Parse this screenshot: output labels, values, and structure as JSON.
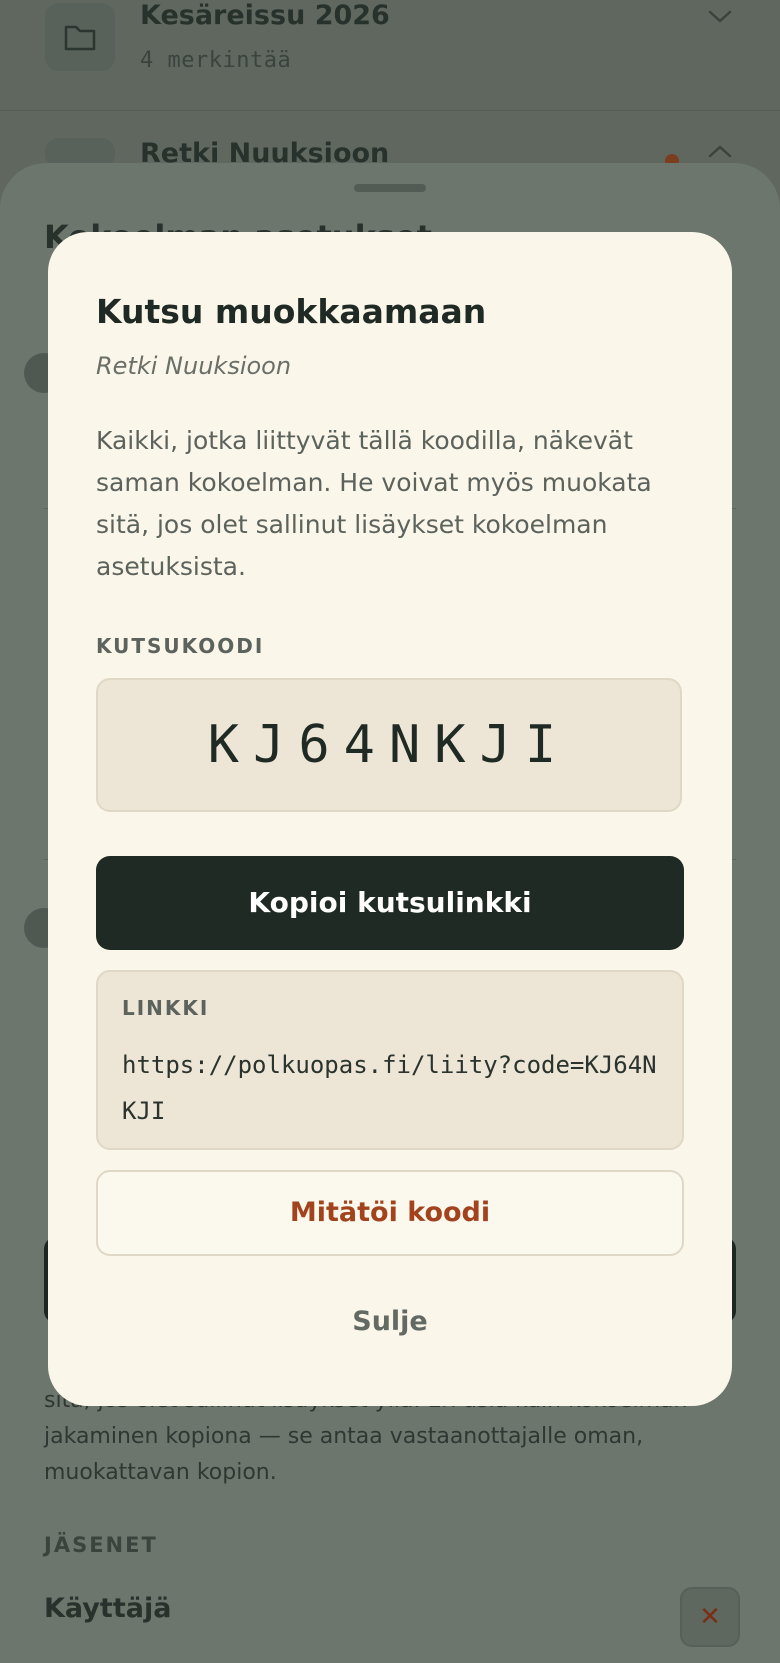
{
  "background_list": {
    "rows": [
      {
        "title": "Kesäreissu 2026",
        "subtitle": "4 merkintää"
      },
      {
        "title": "Retki Nuuksioon"
      }
    ]
  },
  "sheet": {
    "heading": "Kokoelman asetukset",
    "description_tail": "sitä, jos olet sallinut lisäykset yllä. Eri asia kuin kokoelman jakaminen kopiona — se antaa vastaanottajalle oman, muokattavan kopion.",
    "members_label": "JÄSENET",
    "member_name": "Käyttäjä"
  },
  "dialog": {
    "title": "Kutsu muokkaamaan",
    "subtitle": "Retki Nuuksioon",
    "description": "Kaikki, jotka liittyvät tällä koodilla, näkevät saman kokoelman. He voivat myös muokata sitä, jos olet sallinut lisäykset kokoelman asetuksista.",
    "code_label": "KUTSUKOODI",
    "code": "KJ64NKJI",
    "copy_button": "Kopioi kutsulinkki",
    "link_label": "LINKKI",
    "link_url": "https://polkuopas.fi/liity?code=KJ64NKJI",
    "revoke_button": "Mitätöi koodi",
    "close_button": "Sulje"
  },
  "colors": {
    "primary": "#1e2a23",
    "danger": "#a3431e",
    "surface": "#faf6ea"
  },
  "icons": [
    "folder-icon",
    "chevron-down-icon",
    "chevron-up-icon",
    "close-icon"
  ]
}
